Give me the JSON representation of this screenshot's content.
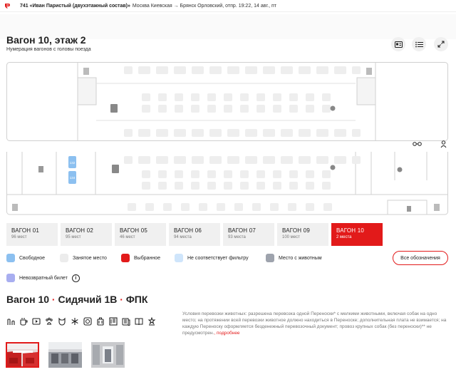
{
  "topbar": {
    "train_name": "741 «Иван Паристый (двухэтажный состав)»",
    "route": "Москва Киевская → Брянск Орловский, отпр. 19:22, 14 авг., пт"
  },
  "wagon": {
    "title": "Вагон 10, этаж 2",
    "subtitle": "Нумерация вагонов с головы поезда"
  },
  "tools": [
    "scheme-icon",
    "list-icon",
    "expand-icon"
  ],
  "view_toggles": [
    "glasses-icon",
    "person-pin-icon"
  ],
  "plan_labels": {
    "seat_a": "132",
    "seat_b": "134",
    "wc": "WC"
  },
  "tabs": [
    {
      "name": "ВАГОН 01",
      "seats": "96 мест"
    },
    {
      "name": "ВАГОН 02",
      "seats": "95 мест"
    },
    {
      "name": "ВАГОН 05",
      "seats": "46 мест"
    },
    {
      "name": "ВАГОН 06",
      "seats": "94 места"
    },
    {
      "name": "ВАГОН 07",
      "seats": "93 места"
    },
    {
      "name": "ВАГОН 09",
      "seats": "100 мест"
    },
    {
      "name": "ВАГОН 10",
      "seats": "2 места"
    }
  ],
  "active_tab": 6,
  "legend": {
    "free": "Свободное",
    "occupied": "Занятое место",
    "selected": "Выбранное",
    "not_matching": "Не соответствует фильтру",
    "pets": "Место с животным",
    "non_refundable": "Невозвратный билет",
    "all_button": "Все обозначения"
  },
  "colors": {
    "accent": "#e21a1a",
    "free": "#8cc0f0",
    "occupied": "#ececec",
    "selected": "#e21a1a",
    "not_matching": "#cfe5fb",
    "pets": "#9ea3ad",
    "non_refundable": "#a8aef0"
  },
  "car_info": {
    "title": "Вагон 10",
    "class": "Сидячий 1В",
    "carrier": "ФПК",
    "separator": "·"
  },
  "services": [
    "restroom-icon",
    "coffee-icon",
    "tv-icon",
    "pet-paw-icon",
    "pet-icon",
    "snowflake-icon",
    "socket-icon",
    "luggage-icon",
    "restaurant-icon",
    "press-icon",
    "book-icon",
    "hygiene-icon"
  ],
  "rules": {
    "text": "Условия перевозки животных: разрешена перевозка одной Переноски* с мелкими животными, включая собак на одно место; на протяжении всей перевозки животное должно находиться в Переноске; дополнительная плата не взимается; на каждую Переноску оформляется безденежный перевозочный документ; провоз крупных собак (без переноски)** не предусмотрен.",
    "more": ", подробнее"
  },
  "photos": [
    "red-seats-photo",
    "salon-photo",
    "corridor-photo"
  ]
}
